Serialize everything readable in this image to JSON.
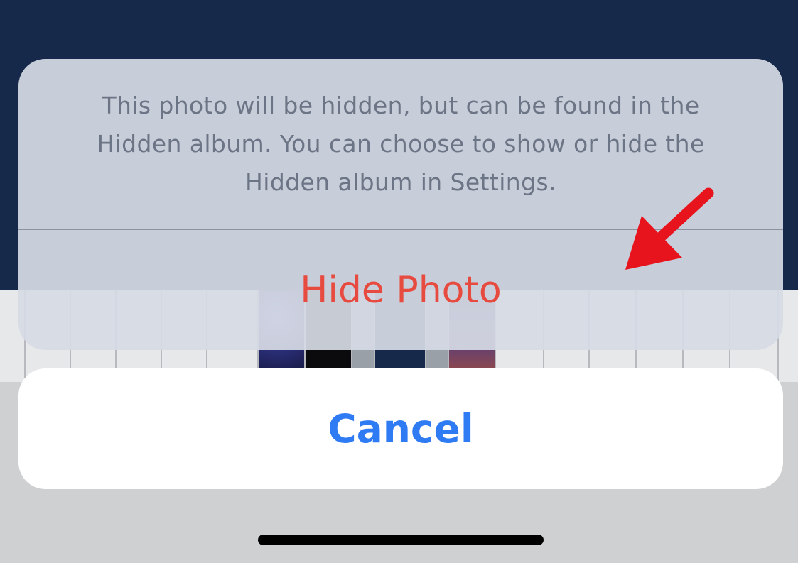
{
  "action_sheet": {
    "message": "This photo will be hidden, but can be found in the Hidden album. You can choose to show or hide the Hidden album in Settings.",
    "hide_label": "Hide Photo",
    "cancel_label": "Cancel"
  },
  "colors": {
    "destructive": "#e74a3e",
    "cancel": "#2f7bf3",
    "annotation_arrow": "#e8141d"
  },
  "annotation": {
    "icon": "arrow-pointer-icon"
  }
}
